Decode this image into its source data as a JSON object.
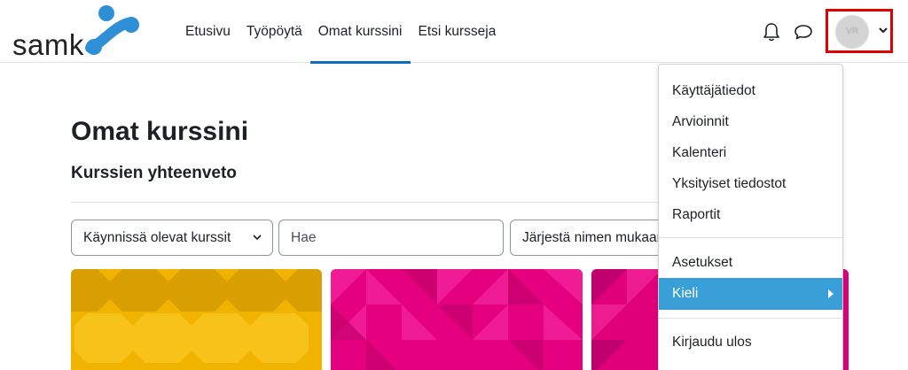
{
  "logo": {
    "text": "samk",
    "colors": {
      "blue": "#2f8fd6",
      "text": "#222222"
    }
  },
  "nav": {
    "items": [
      {
        "label": "Etusivu",
        "active": false
      },
      {
        "label": "Työpöytä",
        "active": false
      },
      {
        "label": "Omat kurssini",
        "active": true
      },
      {
        "label": "Etsi kursseja",
        "active": false
      }
    ]
  },
  "header_icons": {
    "notifications": "bell-icon",
    "messages": "chat-bubble-icon"
  },
  "user_menu": {
    "avatar_initials": "VR",
    "caret": "chevron-down-icon",
    "highlight_color": "#e00000"
  },
  "page": {
    "title": "Omat kurssini",
    "section_title": "Kurssien yhteenveto"
  },
  "filters": {
    "grouping": "Käynnissä olevat kurssit",
    "search_placeholder": "Hae",
    "sort": "Järjestä nimen mukaan"
  },
  "courses": [
    {
      "image_color": "#f0b400",
      "pattern": "octagons"
    },
    {
      "image_color": "#e4007f",
      "pattern": "triangles"
    },
    {
      "image_color": "#e0007a",
      "pattern": "triangles"
    }
  ],
  "dropdown": {
    "items": [
      {
        "label": "Käyttäjätiedot"
      },
      {
        "label": "Arvioinnit"
      },
      {
        "label": "Kalenteri"
      },
      {
        "label": "Yksityiset tiedostot"
      },
      {
        "label": "Raportit"
      }
    ],
    "items2": [
      {
        "label": "Asetukset"
      },
      {
        "label": "Kieli",
        "active": true,
        "has_submenu": true
      }
    ],
    "items3": [
      {
        "label": "Kirjaudu ulos"
      }
    ],
    "active_color": "#3a9fd6"
  }
}
